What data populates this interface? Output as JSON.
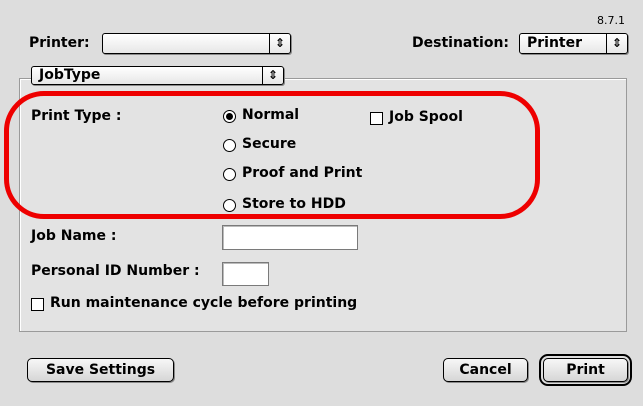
{
  "version": "8.7.1",
  "printer": {
    "label": "Printer:",
    "value": ""
  },
  "destination": {
    "label": "Destination:",
    "value": "Printer"
  },
  "section_popup": {
    "value": "JobType"
  },
  "print_type": {
    "label": "Print Type :",
    "options": [
      "Normal",
      "Secure",
      "Proof and Print",
      "Store to HDD"
    ],
    "selected": "Normal"
  },
  "job_spool": {
    "label": "Job Spool",
    "checked": false
  },
  "job_name": {
    "label": "Job Name :",
    "value": ""
  },
  "personal_id": {
    "label": "Personal ID Number :",
    "value": ""
  },
  "maintenance": {
    "label": "Run maintenance cycle before printing",
    "checked": false
  },
  "buttons": {
    "save_settings": "Save Settings",
    "cancel": "Cancel",
    "print": "Print"
  },
  "icons": {
    "popup_arrow": "up-down-arrows-icon"
  },
  "colors": {
    "highlight": "#ee0000",
    "background": "#dddddd"
  }
}
